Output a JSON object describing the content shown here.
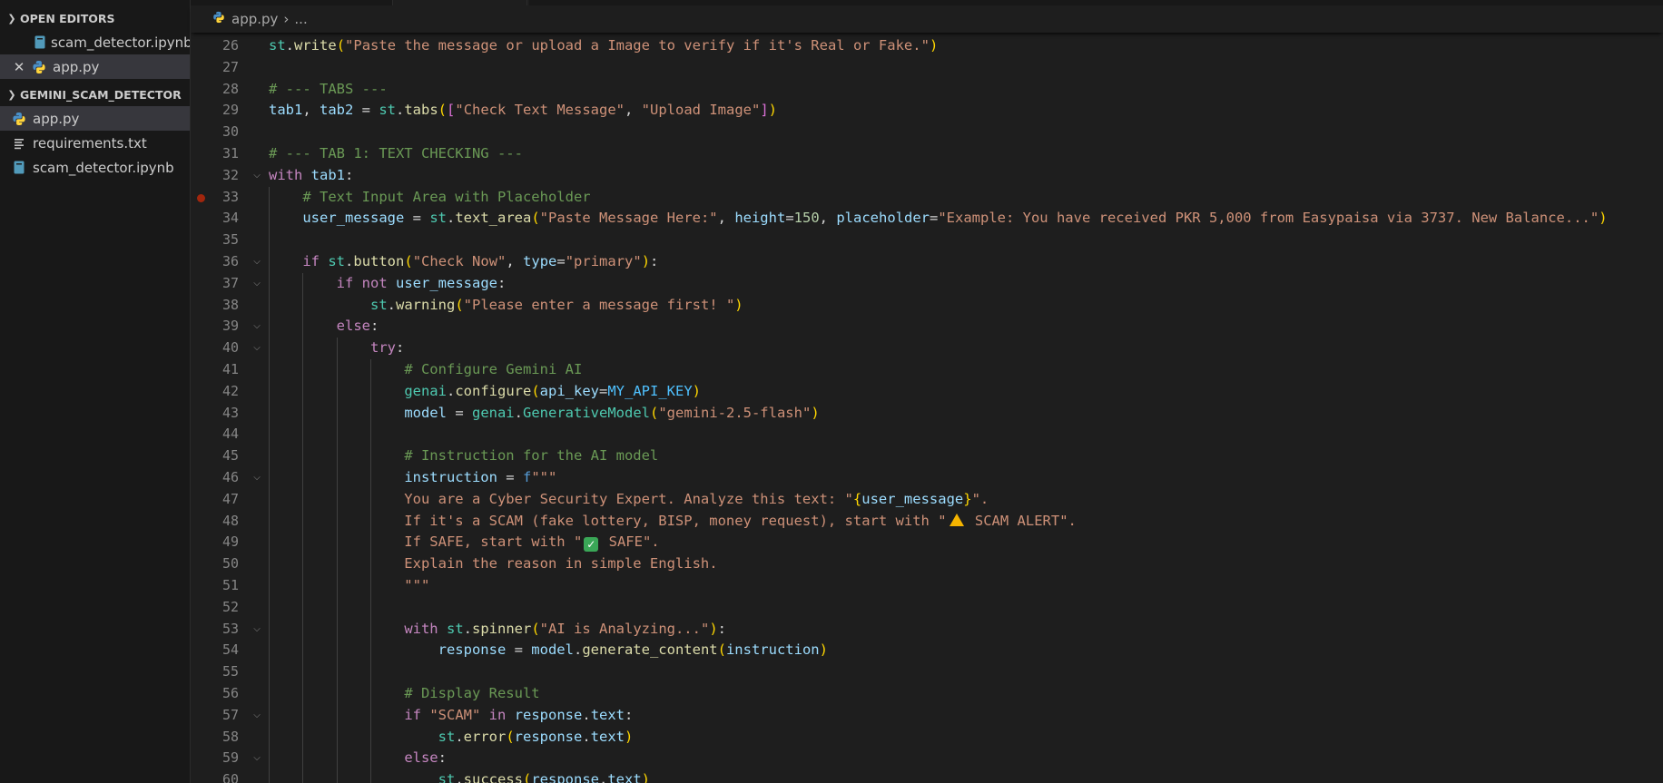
{
  "sidebar": {
    "open_editors": {
      "title": "OPEN EDITORS",
      "items": [
        {
          "label": "scam_detector.ipynb",
          "icon": "notebook-icon"
        },
        {
          "label": "app.py",
          "icon": "python-icon",
          "close_glyph": "✕"
        }
      ]
    },
    "workspace": {
      "title": "GEMINI_SCAM_DETECTOR",
      "items": [
        {
          "label": "app.py",
          "icon": "python-icon"
        },
        {
          "label": "requirements.txt",
          "icon": "text-file-icon"
        },
        {
          "label": "scam_detector.ipynb",
          "icon": "notebook-icon"
        }
      ]
    }
  },
  "editor": {
    "breadcrumb": {
      "file": "app.py",
      "more": "..."
    },
    "breakpoint_line": 33,
    "lines": [
      {
        "n": "26",
        "text": "st.write(\"Paste the message or upload a Image to verify if it's Real or Fake.\")"
      },
      {
        "n": "27",
        "text": ""
      },
      {
        "n": "28",
        "text": "# --- TABS ---"
      },
      {
        "n": "29",
        "text": "tab1, tab2 = st.tabs([\"Check Text Message\", \"Upload Image\"])"
      },
      {
        "n": "30",
        "text": ""
      },
      {
        "n": "31",
        "text": "# --- TAB 1: TEXT CHECKING ---"
      },
      {
        "n": "32",
        "text": "with tab1:"
      },
      {
        "n": "33",
        "text": "    # Text Input Area with Placeholder"
      },
      {
        "n": "34",
        "text": "    user_message = st.text_area(\"Paste Message Here:\", height=150, placeholder=\"Example: You have received PKR 5,000 from Easypaisa via 3737. New Balance...\")"
      },
      {
        "n": "35",
        "text": ""
      },
      {
        "n": "36",
        "text": "    if st.button(\"Check Now\", type=\"primary\"):"
      },
      {
        "n": "37",
        "text": "        if not user_message:"
      },
      {
        "n": "38",
        "text": "            st.warning(\"Please enter a message first! \")"
      },
      {
        "n": "39",
        "text": "        else:"
      },
      {
        "n": "40",
        "text": "            try:"
      },
      {
        "n": "41",
        "text": "                # Configure Gemini AI"
      },
      {
        "n": "42",
        "text": "                genai.configure(api_key=MY_API_KEY)"
      },
      {
        "n": "43",
        "text": "                model = genai.GenerativeModel(\"gemini-2.5-flash\")"
      },
      {
        "n": "44",
        "text": ""
      },
      {
        "n": "45",
        "text": "                # Instruction for the AI model"
      },
      {
        "n": "46",
        "text": "                instruction = f\"\"\""
      },
      {
        "n": "47",
        "text": "                You are a Cyber Security Expert. Analyze this text: \"{user_message}\"."
      },
      {
        "n": "48",
        "text": "                If it's a SCAM (fake lottery, BISP, money request), start with \"⚠️ SCAM ALERT\"."
      },
      {
        "n": "49",
        "text": "                If SAFE, start with \"✅ SAFE\"."
      },
      {
        "n": "50",
        "text": "                Explain the reason in simple English."
      },
      {
        "n": "51",
        "text": "                \"\"\""
      },
      {
        "n": "52",
        "text": ""
      },
      {
        "n": "53",
        "text": "                with st.spinner(\"AI is Analyzing...\"):"
      },
      {
        "n": "54",
        "text": "                    response = model.generate_content(instruction)"
      },
      {
        "n": "55",
        "text": ""
      },
      {
        "n": "56",
        "text": "                # Display Result"
      },
      {
        "n": "57",
        "text": "                if \"SCAM\" in response.text:"
      },
      {
        "n": "58",
        "text": "                    st.error(response.text)"
      },
      {
        "n": "59",
        "text": "                else:"
      },
      {
        "n": "60",
        "text": "                    st.success(response.text)"
      }
    ]
  }
}
